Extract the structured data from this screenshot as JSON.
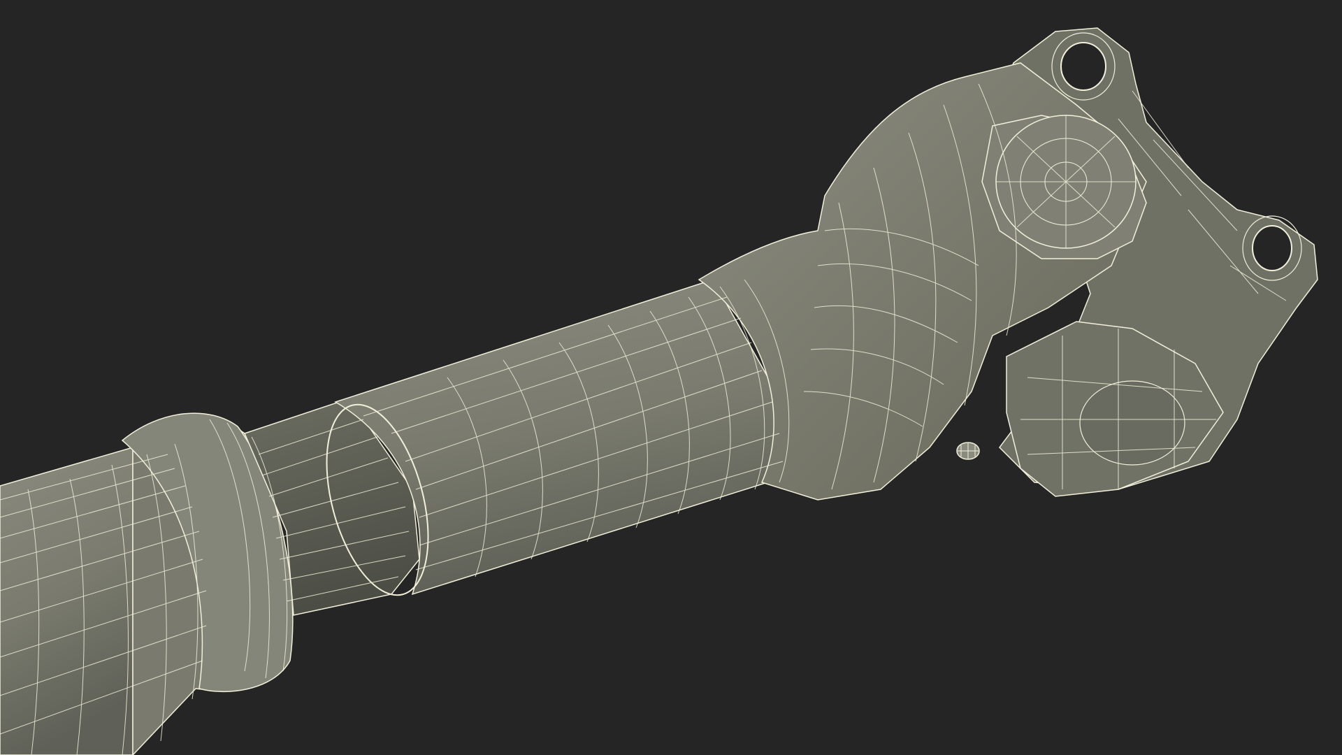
{
  "scene": {
    "subject": "driveshaft-wireframe-render",
    "colors": {
      "background": "#252525",
      "surface": "#7d7e71",
      "surface_light": "#8c8d80",
      "surface_dark": "#5e5f56",
      "wire": "#f2f0da"
    }
  }
}
